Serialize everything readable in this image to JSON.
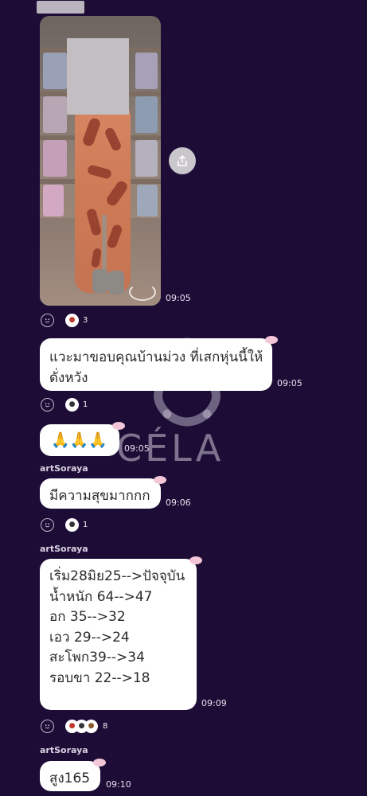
{
  "messages": {
    "photo": {
      "time": "09:05",
      "reaction_count": "3"
    },
    "msg1": {
      "line1": "แวะมาขอบคุณบ้านม่วง ที่เสกหุ่นนี้ให้",
      "line2": "ดั่งหวัง",
      "time": "09:05",
      "reaction_count": "1"
    },
    "msg2": {
      "text": "🙏🙏🙏",
      "time": "09:05"
    },
    "msg3": {
      "sender": "artSoraya",
      "text": "มีความสุขมากกก",
      "time": "09:06",
      "reaction_count": "1"
    },
    "msg4": {
      "sender": "artSoraya",
      "lines": [
        "เริ่ม28มิย25-->ปัจจุบัน",
        "น้ำหนัก 64-->47",
        "อก 35-->32",
        "เอว 29-->24",
        "สะโพก39-->34",
        "รอบขา 22-->18"
      ],
      "time": "09:09",
      "reaction_count": "8"
    },
    "msg5": {
      "sender": "artSoraya",
      "text": "สูง165",
      "time": "09:10"
    }
  },
  "watermark": {
    "brand": "CÉLA"
  },
  "icons": {
    "share": "share-icon",
    "add_reaction": "smile-icon"
  }
}
